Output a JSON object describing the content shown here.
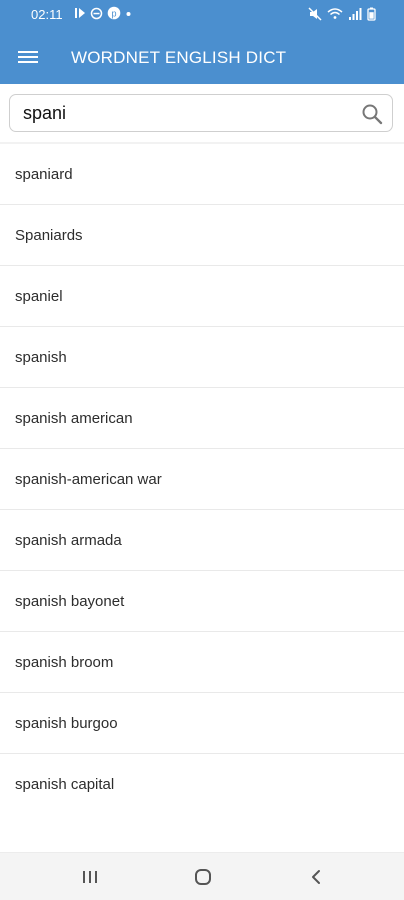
{
  "status_bar": {
    "time": "02:11",
    "icons_left": [
      "media-play-icon",
      "circle-minus-icon",
      "pinterest-icon",
      "dot-icon"
    ],
    "icons_right": [
      "mute-icon",
      "wifi-icon",
      "signal-icon",
      "battery-icon"
    ]
  },
  "app_bar": {
    "title": "WORDNET ENGLISH DICT",
    "background": "#4b8fcf"
  },
  "search": {
    "value": "spani",
    "icon": "search-icon"
  },
  "results": [
    {
      "word": "spaniard"
    },
    {
      "word": "Spaniards"
    },
    {
      "word": "spaniel"
    },
    {
      "word": "spanish"
    },
    {
      "word": "spanish american"
    },
    {
      "word": "spanish-american war"
    },
    {
      "word": "spanish armada"
    },
    {
      "word": "spanish bayonet"
    },
    {
      "word": "spanish broom"
    },
    {
      "word": "spanish burgoo"
    },
    {
      "word": "spanish capital"
    }
  ],
  "navigation": {
    "recents_icon": "recents-icon",
    "home_icon": "home-icon",
    "back_icon": "back-icon"
  }
}
